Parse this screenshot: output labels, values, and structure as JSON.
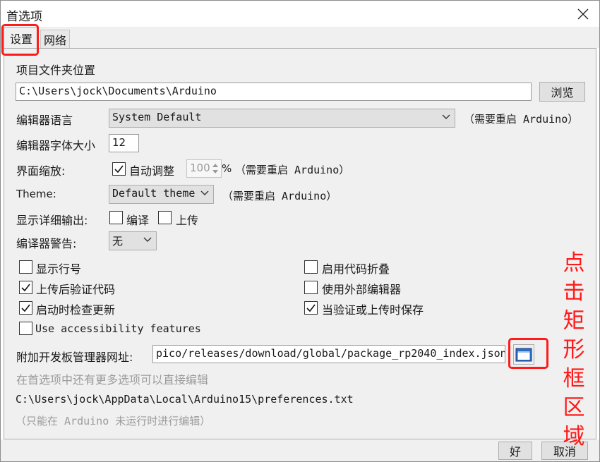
{
  "window": {
    "title": "首选项",
    "close_icon": "close-icon"
  },
  "tabs": [
    {
      "label": "设置"
    },
    {
      "label": "网络"
    }
  ],
  "sketchbook": {
    "label": "项目文件夹位置",
    "value": "C:\\Users\\jock\\Documents\\Arduino",
    "browse_label": "浏览"
  },
  "editor_language": {
    "label": "编辑器语言",
    "value": "System Default",
    "note": "（需要重启 Arduino）"
  },
  "font_size": {
    "label": "编辑器字体大小",
    "value": "12"
  },
  "scale": {
    "label": "界面缩放:",
    "auto_label": "自动调整",
    "auto_checked": true,
    "value": "100",
    "unit": "%",
    "note": "（需要重启 Arduino）"
  },
  "theme": {
    "label": "Theme:",
    "value": "Default theme",
    "note": "（需要重启 Arduino）"
  },
  "verbose": {
    "label": "显示详细输出:",
    "compile_label": "编译",
    "compile_checked": false,
    "upload_label": "上传",
    "upload_checked": false
  },
  "warnings": {
    "label": "编译器警告:",
    "value": "无"
  },
  "options_left": [
    {
      "label": "显示行号",
      "checked": false
    },
    {
      "label": "上传后验证代码",
      "checked": true
    },
    {
      "label": "启动时检查更新",
      "checked": true
    },
    {
      "label": "Use accessibility features",
      "checked": false
    }
  ],
  "options_right": [
    {
      "label": "启用代码折叠",
      "checked": false
    },
    {
      "label": "使用外部编辑器",
      "checked": false
    },
    {
      "label": "当验证或上传时保存",
      "checked": true
    }
  ],
  "board_manager": {
    "label": "附加开发板管理器网址:",
    "value": "pico/releases/download/global/package_rp2040_index.json",
    "edit_icon": "window-edit-icon"
  },
  "more_options_hint": "在首选项中还有更多选项可以直接编辑",
  "prefs_path": "C:\\Users\\jock\\AppData\\Local\\Arduino15\\preferences.txt",
  "prefs_note": "（只能在 Arduino 未运行时进行编辑）",
  "footer": {
    "ok_label": "好",
    "cancel_label": "取消"
  },
  "annotation": {
    "text": "点击矩形框区域",
    "color": "#ff1a1a"
  }
}
